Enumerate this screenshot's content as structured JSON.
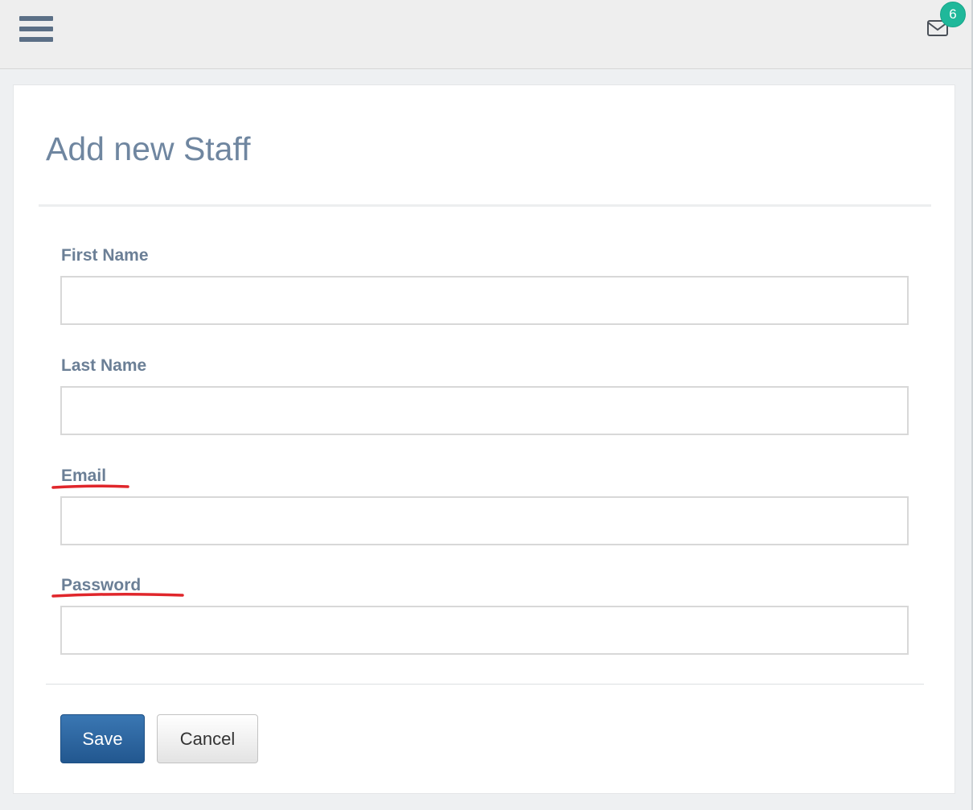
{
  "header": {
    "menu_icon": "hamburger-icon",
    "mail_icon": "envelope-icon",
    "notification_count": "6",
    "badge_color": "#1fb89a"
  },
  "page": {
    "title": "Add new Staff"
  },
  "form": {
    "fields": [
      {
        "label": "First Name",
        "value": "",
        "placeholder": ""
      },
      {
        "label": "Last Name",
        "value": "",
        "placeholder": ""
      },
      {
        "label": "Email",
        "value": "",
        "placeholder": ""
      },
      {
        "label": "Password",
        "value": "",
        "placeholder": ""
      }
    ],
    "annotation_color": "#e0262b"
  },
  "actions": {
    "save_label": "Save",
    "cancel_label": "Cancel",
    "save_color": "#2e6aa3"
  }
}
